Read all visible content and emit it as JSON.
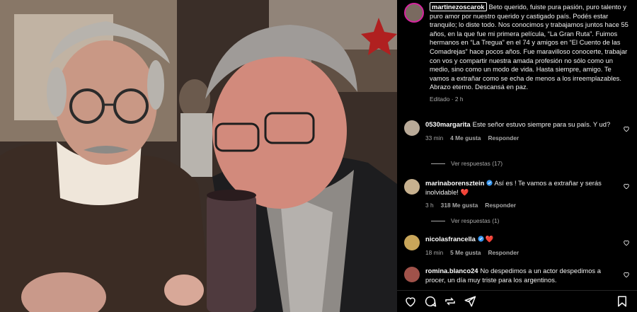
{
  "post": {
    "username": "martinezoscarok",
    "caption": "Beto querido, fuiste pura pasión, puro talento y puro amor por nuestro querido y castigado país. Podés estar tranquilo; lo diste todo. Nos conocimos y trabajamos juntos hace 55 años, en la que fue mi primera película, “La Gran Ruta”. Fuimos hermanos en “La Tregua” en el 74 y amigos en “El Cuento de las Comadrejas” hace pocos años. Fue maravilloso conocerte, trabajar con vos y compartir nuestra amada profesión no sólo como un medio, sino como un modo de vida. Hasta siempre, amigo. Te vamos a extrañar como se echa de menos a los irreemplazables. Abrazo eterno. Descansá en paz.",
    "meta": "Editado · 2 h"
  },
  "comments": [
    {
      "username": "0530margarita",
      "verified": false,
      "text": "Este señor estuvo siempre para su país. Y ud?",
      "time": "33 min",
      "likes": "4 Me gusta",
      "reply": "Responder",
      "view_replies": "Ver respuestas (17)"
    },
    {
      "username": "marinaborensztein",
      "verified": true,
      "text": "Así es ! Te vamos a extrañar y serás inolvidable! ❤️",
      "time": "3 h",
      "likes": "318 Me gusta",
      "reply": "Responder",
      "view_replies": "Ver respuestas (1)"
    },
    {
      "username": "nicolasfrancella",
      "verified": true,
      "text": "❤️",
      "time": "18 min",
      "likes": "5 Me gusta",
      "reply": "Responder"
    },
    {
      "username": "romina.blanco24",
      "verified": false,
      "text": "No despedimos a un actor despedimos a procer, un día muy triste para los argentinos."
    }
  ],
  "icons": {
    "like": "heart-outline-icon",
    "comment": "speech-bubble-icon",
    "share": "repost-icon",
    "send": "paper-plane-icon",
    "save": "bookmark-icon"
  },
  "colors": {
    "background": "#000000",
    "meta": "#a8a8a8",
    "verified": "#3897f0",
    "story_ring": "#d6249f"
  }
}
